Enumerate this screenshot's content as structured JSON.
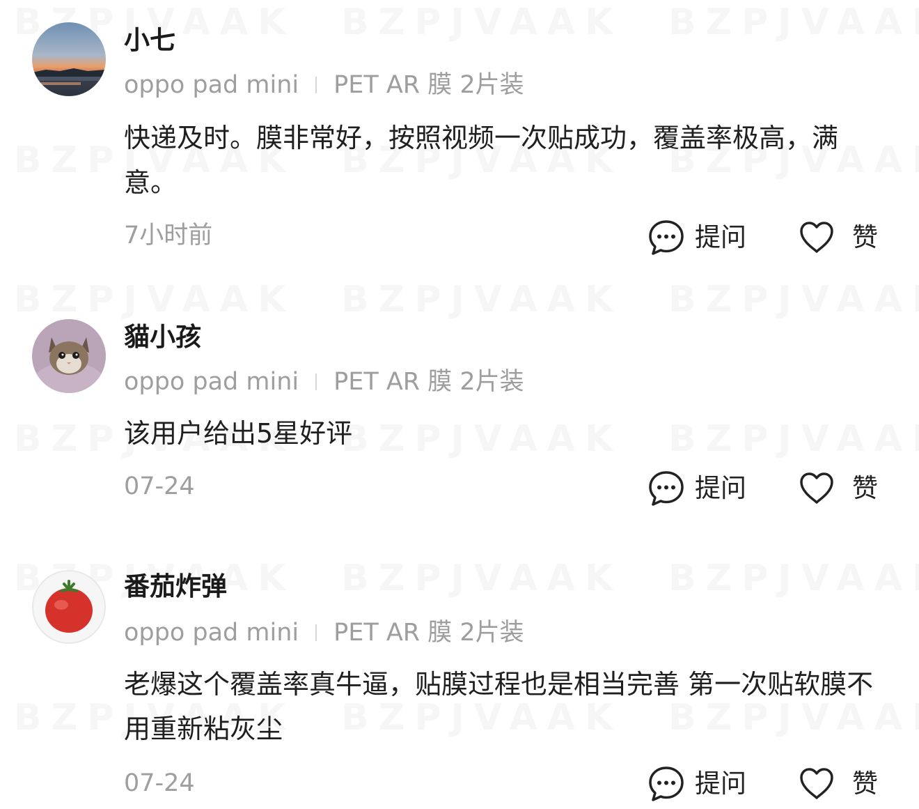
{
  "watermark": "BZPJVAAK",
  "actions": {
    "ask_label": "提问",
    "like_label": "赞"
  },
  "reviews": [
    {
      "user": "小七",
      "avatar": "sunset-lake-photo",
      "device": "oppo pad mini",
      "spec": "PET AR 膜 2片装",
      "text": "快递及时。膜非常好，按照视频一次贴成功，覆盖率极高，满意。",
      "time": "7小时前"
    },
    {
      "user": "貓小孩",
      "avatar": "kitten-photo",
      "device": "oppo pad mini",
      "spec": "PET AR 膜 2片装",
      "text": "该用户给出5星好评",
      "time": "07-24"
    },
    {
      "user": "番茄炸弹",
      "avatar": "tomato-photo",
      "device": "oppo pad mini",
      "spec": "PET AR 膜 2片装",
      "text": "老爆这个覆盖率真牛逼，贴膜过程也是相当完善 第一次贴软膜不用重新粘灰尘",
      "time": "07-24"
    }
  ]
}
